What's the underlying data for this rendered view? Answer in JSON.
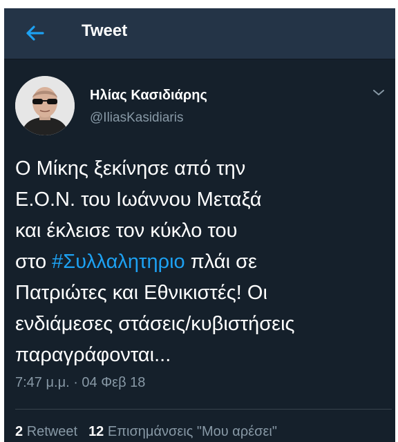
{
  "header": {
    "title": "Tweet"
  },
  "author": {
    "name": "Ηλίας Κασιδιάρης",
    "handle": "@IliasKasidiaris"
  },
  "tweet": {
    "lines": [
      "Ο Μίκης ξεκίνησε από την",
      "Ε.Ο.Ν. του Ιωάννου Μεταξά",
      "και έκλεισε τον κύκλο του"
    ],
    "line4_before": "στο ",
    "hashtag": "#Συλλαλητηριο",
    "line4_after": " πλάι σε",
    "lines_end": [
      "Πατριώτες και Εθνικιστές! Οι",
      "ενδιάμεσες στάσεις/κυβιστήσεις",
      "παραγράφονται..."
    ],
    "timestamp": "7:47 μ.μ. · 04 Φεβ 18"
  },
  "stats": {
    "retweets": "2",
    "retweets_label": "Retweet",
    "likes": "12",
    "likes_label": "Επισημάνσεις \"Μου αρέσει\""
  },
  "icons": {
    "back": "back-arrow-icon",
    "more": "chevron-down-icon"
  },
  "colors": {
    "accent": "#1da1f2",
    "background": "#15202b",
    "header": "#243447",
    "muted": "#8899a6"
  }
}
